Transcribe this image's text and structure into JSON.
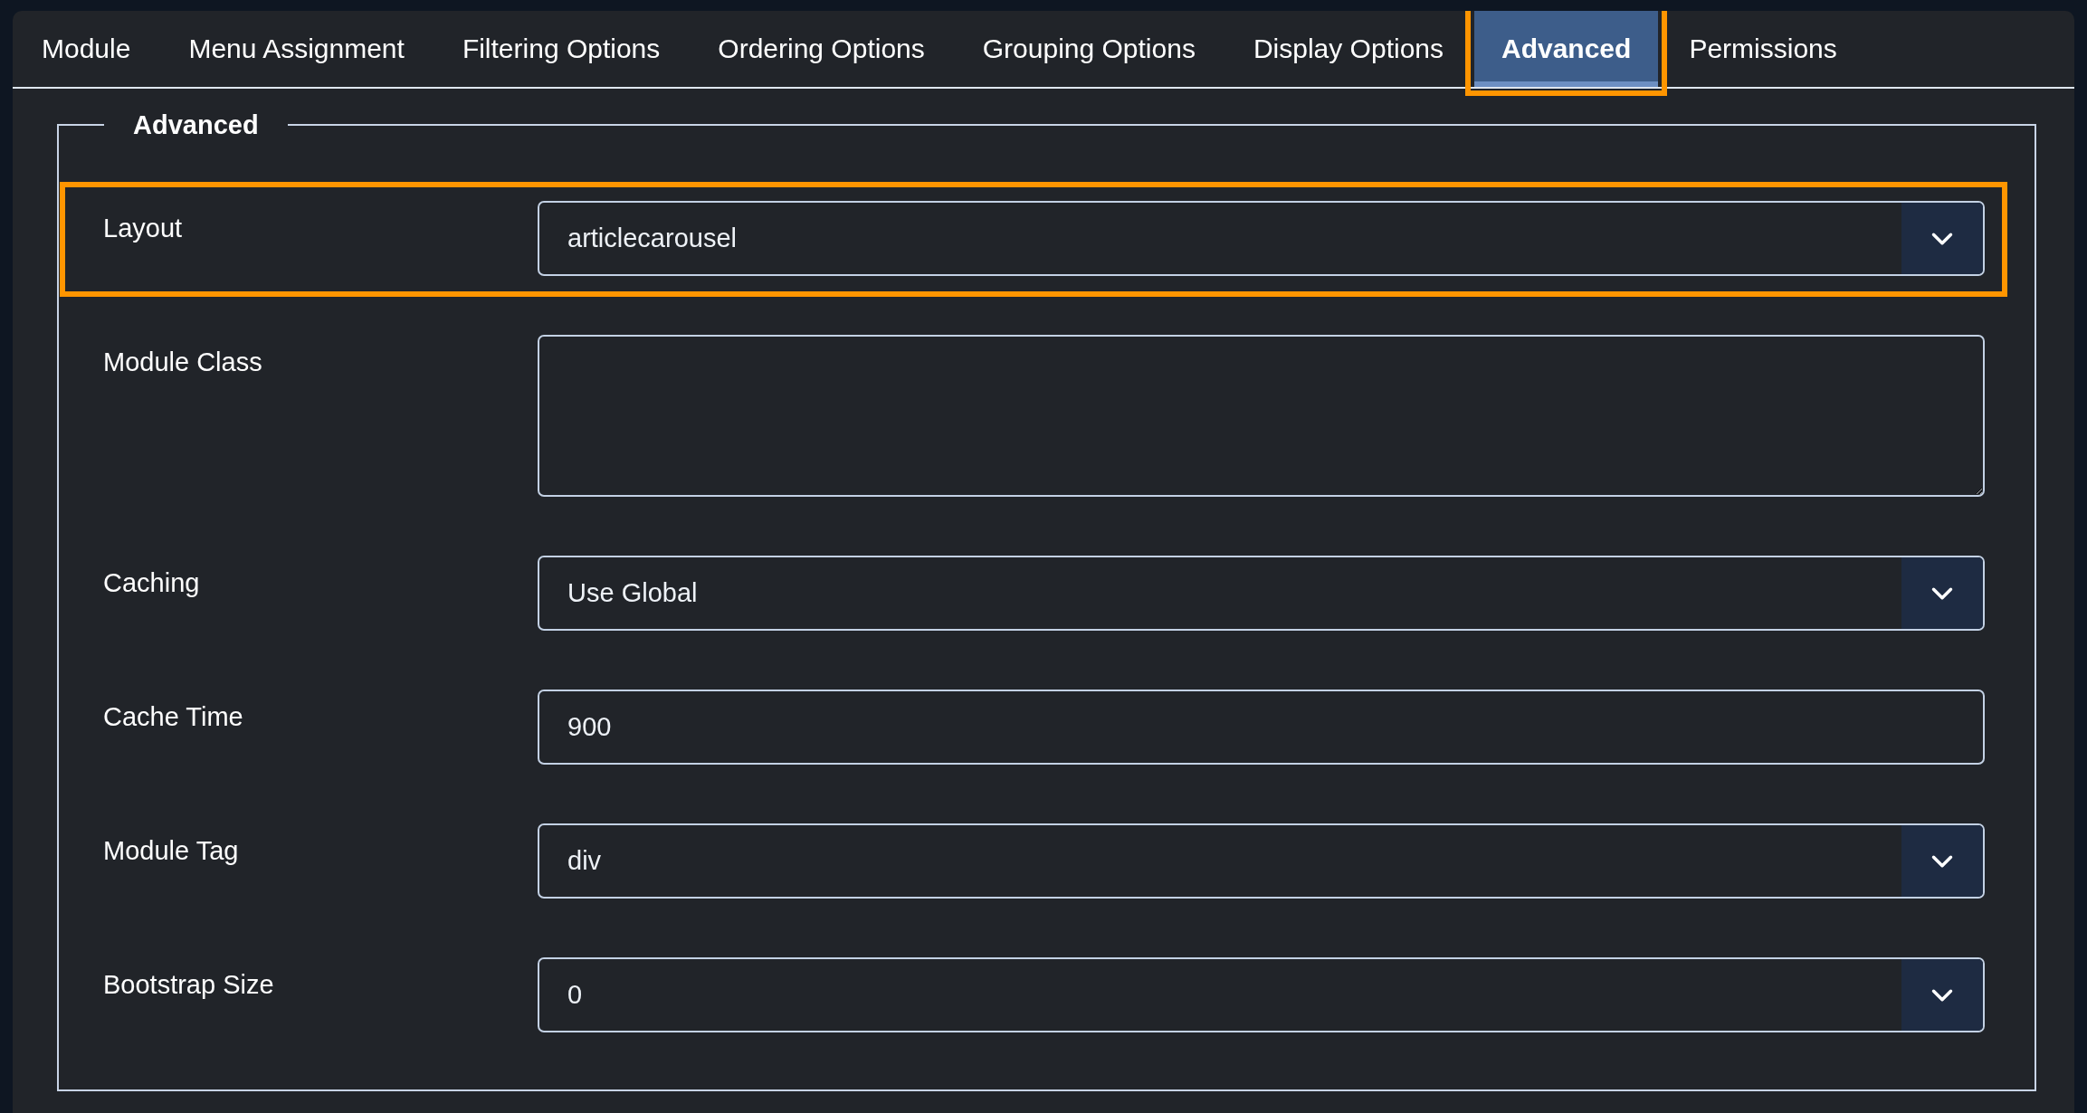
{
  "tabs": [
    {
      "label": "Module",
      "selected": false,
      "highlighted": false
    },
    {
      "label": "Menu Assignment",
      "selected": false,
      "highlighted": false
    },
    {
      "label": "Filtering Options",
      "selected": false,
      "highlighted": false
    },
    {
      "label": "Ordering Options",
      "selected": false,
      "highlighted": false
    },
    {
      "label": "Grouping Options",
      "selected": false,
      "highlighted": false
    },
    {
      "label": "Display Options",
      "selected": false,
      "highlighted": false
    },
    {
      "label": "Advanced",
      "selected": true,
      "highlighted": true
    },
    {
      "label": "Permissions",
      "selected": false,
      "highlighted": false
    }
  ],
  "fieldset": {
    "legend": "Advanced",
    "fields": [
      {
        "kind": "select",
        "label": "Layout",
        "value": "articlecarousel",
        "highlighted": true
      },
      {
        "kind": "textarea",
        "label": "Module Class",
        "highlighted": false
      },
      {
        "kind": "select",
        "label": "Caching",
        "value": "Use Global",
        "highlighted": false
      },
      {
        "kind": "text",
        "label": "Cache Time",
        "value": "900",
        "highlighted": false
      },
      {
        "kind": "select",
        "label": "Module Tag",
        "value": "div",
        "highlighted": false
      },
      {
        "kind": "select",
        "label": "Bootstrap Size",
        "value": "0",
        "highlighted": false
      }
    ]
  }
}
